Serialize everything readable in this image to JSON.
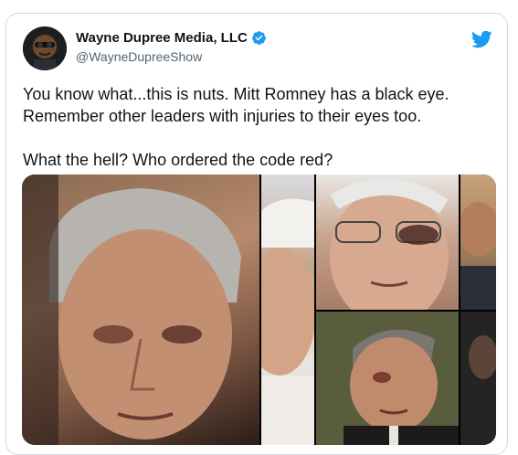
{
  "tweet": {
    "display_name": "Wayne Dupree Media, LLC",
    "handle": "@WayneDupreeShow",
    "text": "You know what...this is nuts. Mitt Romney has a black eye.\nRemember other leaders with injuries to their eyes too.\n\nWhat the hell? Who ordered the code red?"
  },
  "icons": {
    "verified": "verified-badge-icon",
    "logo": "twitter-bird-icon"
  },
  "colors": {
    "accent": "#1d9bf0",
    "text": "#0f1419",
    "secondary": "#536471",
    "border": "#cfd9de"
  }
}
